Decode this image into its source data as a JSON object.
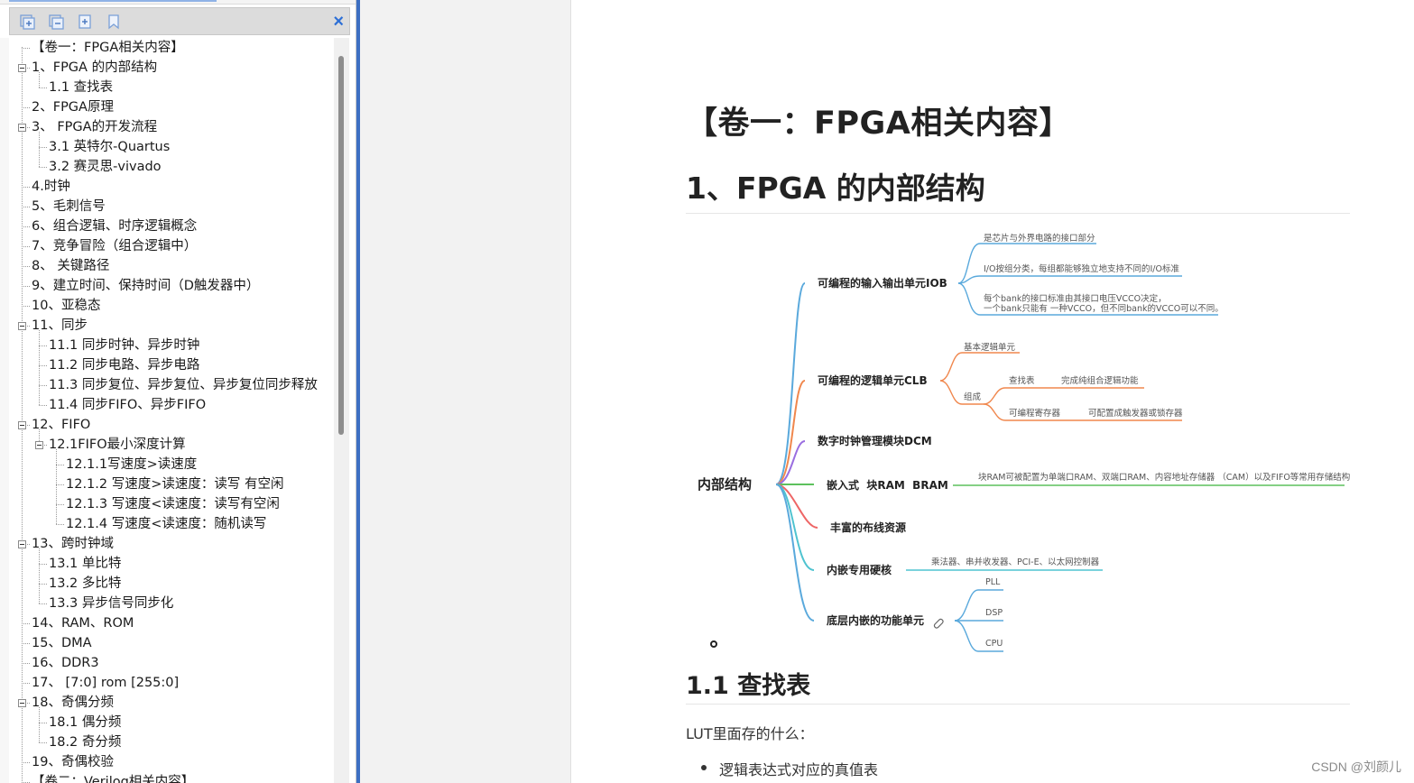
{
  "bookmarks": {
    "toolbar": {
      "close_glyph": "×",
      "icons": [
        "expand-all-icon",
        "collapse-all-icon",
        "add-bookmark-icon",
        "bookmark-icon"
      ]
    },
    "items": [
      {
        "label": "【卷一：FPGA相关内容】",
        "level": 0,
        "toggle": false
      },
      {
        "label": "1、FPGA 的内部结构",
        "level": 0,
        "toggle": true
      },
      {
        "label": "1.1 查找表",
        "level": 1,
        "toggle": false
      },
      {
        "label": "2、FPGA原理",
        "level": 0,
        "toggle": false
      },
      {
        "label": "3、 FPGA的开发流程",
        "level": 0,
        "toggle": true
      },
      {
        "label": "3.1 英特尔-Quartus",
        "level": 1,
        "toggle": false
      },
      {
        "label": "3.2 赛灵思-vivado",
        "level": 1,
        "toggle": false
      },
      {
        "label": "4.时钟",
        "level": 0,
        "toggle": false
      },
      {
        "label": "5、毛刺信号",
        "level": 0,
        "toggle": false
      },
      {
        "label": "6、组合逻辑、时序逻辑概念",
        "level": 0,
        "toggle": false
      },
      {
        "label": "7、竞争冒险（组合逻辑中）",
        "level": 0,
        "toggle": false
      },
      {
        "label": "8、 关键路径",
        "level": 0,
        "toggle": false
      },
      {
        "label": "9、建立时间、保持时间（D触发器中）",
        "level": 0,
        "toggle": false
      },
      {
        "label": "10、亚稳态",
        "level": 0,
        "toggle": false
      },
      {
        "label": "11、同步",
        "level": 0,
        "toggle": true
      },
      {
        "label": "11.1 同步时钟、异步时钟",
        "level": 1,
        "toggle": false
      },
      {
        "label": "11.2 同步电路、异步电路",
        "level": 1,
        "toggle": false
      },
      {
        "label": "11.3 同步复位、异步复位、异步复位同步释放",
        "level": 1,
        "toggle": false
      },
      {
        "label": "11.4 同步FIFO、异步FIFO",
        "level": 1,
        "toggle": false
      },
      {
        "label": "12、FIFO",
        "level": 0,
        "toggle": true
      },
      {
        "label": "12.1FIFO最小深度计算",
        "level": 1,
        "toggle": true
      },
      {
        "label": "12.1.1写速度>读速度",
        "level": 2,
        "toggle": false
      },
      {
        "label": "12.1.2 写速度>读速度：读写 有空闲",
        "level": 2,
        "toggle": false
      },
      {
        "label": "12.1.3 写速度<读速度：读写有空闲",
        "level": 2,
        "toggle": false
      },
      {
        "label": "12.1.4 写速度<读速度：随机读写",
        "level": 2,
        "toggle": false
      },
      {
        "label": "13、跨时钟域",
        "level": 0,
        "toggle": true
      },
      {
        "label": "13.1 单比特",
        "level": 1,
        "toggle": false
      },
      {
        "label": "13.2 多比特",
        "level": 1,
        "toggle": false
      },
      {
        "label": "13.3 异步信号同步化",
        "level": 1,
        "toggle": false
      },
      {
        "label": "14、RAM、ROM",
        "level": 0,
        "toggle": false
      },
      {
        "label": "15、DMA",
        "level": 0,
        "toggle": false
      },
      {
        "label": "16、DDR3",
        "level": 0,
        "toggle": false
      },
      {
        "label": "17、 [7:0] rom [255:0]",
        "level": 0,
        "toggle": false
      },
      {
        "label": "18、奇偶分频",
        "level": 0,
        "toggle": true
      },
      {
        "label": "18.1 偶分频",
        "level": 1,
        "toggle": false
      },
      {
        "label": "18.2 奇分频",
        "level": 1,
        "toggle": false
      },
      {
        "label": "19、奇偶校验",
        "level": 0,
        "toggle": false
      },
      {
        "label": "【卷二：Verilog相关内容】",
        "level": 0,
        "toggle": false
      }
    ]
  },
  "document": {
    "title": "【卷一：FPGA相关内容】",
    "h1": "1、FPGA 的内部结构",
    "h2": "1.1 查找表",
    "paragraph": "LUT里面存的什么：",
    "bullet": "逻辑表达式对应的真值表",
    "stray_mark": "。",
    "watermark": "CSDN @刘颜儿",
    "mindmap": {
      "root": "内部结构",
      "iob": "可编程的输入输出单元IOB",
      "iob_note1": "是芯片与外界电路的接口部分",
      "iob_note2": "I/O按组分类，每组都能够独立地支持不同的I/O标准",
      "iob_note3a": "每个bank的接口标准由其接口电压VCCO决定，",
      "iob_note3b": "一个bank只能有 一种VCCO，但不同bank的VCCO可以不同。",
      "clb": "可编程的逻辑单元CLB",
      "clb_basic": "基本逻辑单元",
      "clb_group": "组成",
      "clb_lut": "查找表",
      "clb_lut_note": "完成纯组合逻辑功能",
      "clb_reg": "可编程寄存器",
      "clb_reg_note": "可配置成触发器或锁存器",
      "dcm": "数字时钟管理模块DCM",
      "bram": "嵌入式  块RAM  BRAM",
      "bram_note": "块RAM可被配置为单端口RAM、双端口RAM、内容地址存储器 （CAM）以及FIFO等常用存储结构",
      "routing": "丰富的布线资源",
      "hardcore": "内嵌专用硬核",
      "hardcore_note": "乘法器、串并收发器、PCI-E、以太网控制器",
      "lowlevel": "底层内嵌的功能单元",
      "pll": "PLL",
      "dsp": "DSP",
      "cpu": "CPU"
    }
  },
  "colors": {
    "splitter": "#3d6fc2",
    "close": "#2d6fd6",
    "blue": "#5aa9dc",
    "orange": "#f0874d",
    "purple": "#9a6ee0",
    "green": "#5dc15d",
    "red": "#ee6666",
    "cyan": "#4fc3d0"
  }
}
